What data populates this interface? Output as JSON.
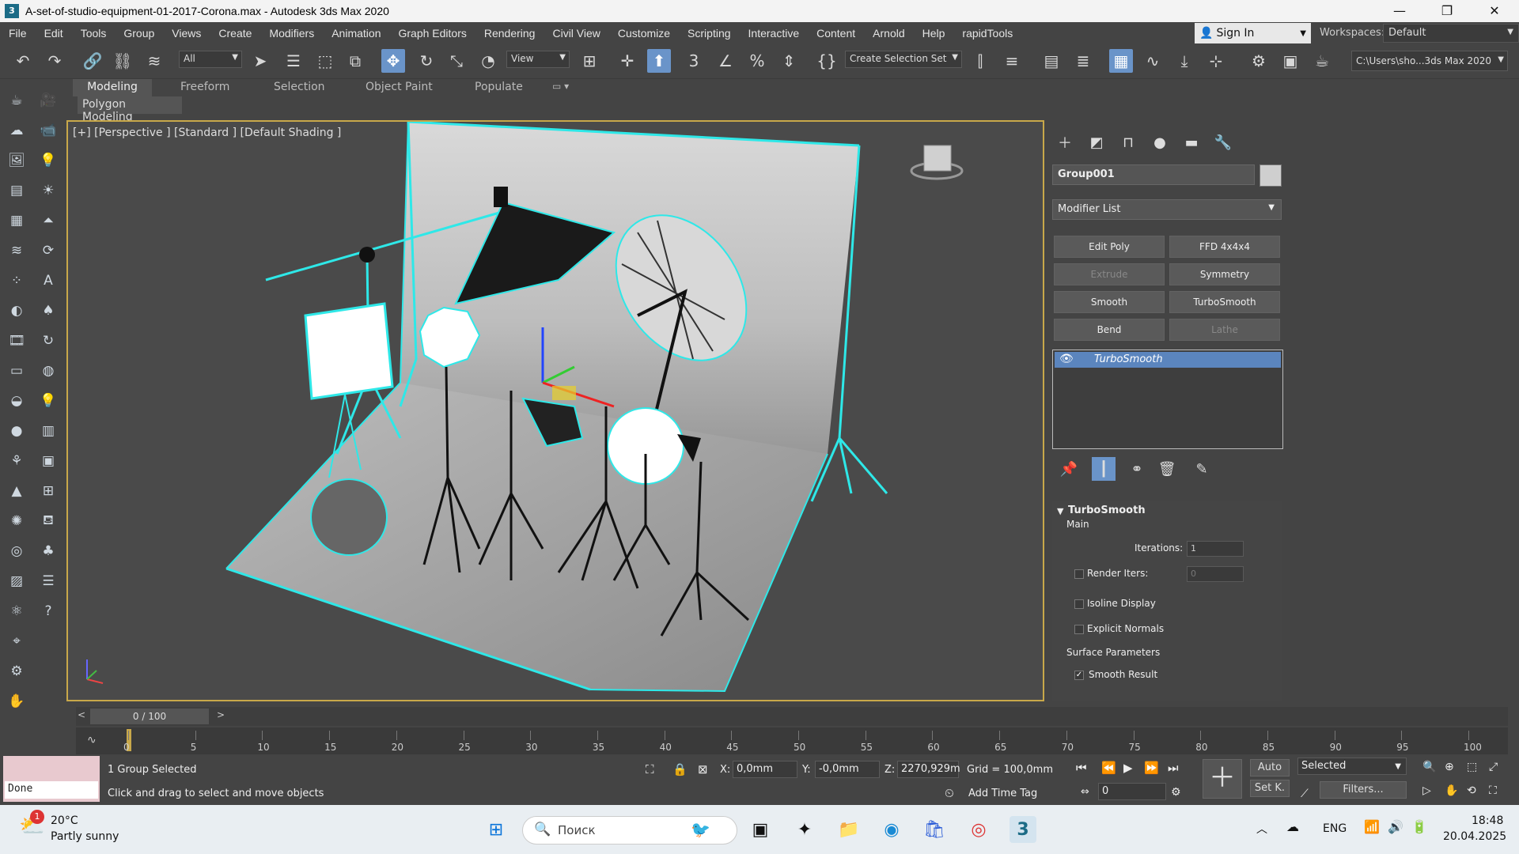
{
  "window": {
    "title": "A-set-of-studio-equipment-01-2017-Corona.max - Autodesk 3ds Max 2020",
    "app_icon": "3",
    "controls": [
      "—",
      "❐",
      "✕"
    ]
  },
  "menu": {
    "items": [
      "File",
      "Edit",
      "Tools",
      "Group",
      "Views",
      "Create",
      "Modifiers",
      "Animation",
      "Graph Editors",
      "Rendering",
      "Civil View",
      "Customize",
      "Scripting",
      "Interactive",
      "Content",
      "Arnold",
      "Help",
      "rapidTools"
    ],
    "signin": "Sign In",
    "workspaces_label": "Workspaces:",
    "workspace_value": "Default"
  },
  "toolbar": {
    "filter_value": "All",
    "refcoord_value": "View",
    "selection_set": "Create Selection Set",
    "project_path": "C:\\Users\\sho...3ds Max 2020"
  },
  "ribbon": {
    "tabs": [
      "Modeling",
      "Freeform",
      "Selection",
      "Object Paint",
      "Populate"
    ],
    "panel": "Polygon Modeling"
  },
  "viewport": {
    "label": "[+] [Perspective ] [Standard ] [Default Shading ]",
    "selection_color": "#2ee8e8",
    "border_color": "#c8a84a"
  },
  "command_panel": {
    "object_name": "Group001",
    "object_color": "#cfcfcf",
    "modifier_list": "Modifier List",
    "buttons": [
      {
        "label": "Edit Poly",
        "enabled": true
      },
      {
        "label": "FFD 4x4x4",
        "enabled": true
      },
      {
        "label": "Extrude",
        "enabled": false
      },
      {
        "label": "Symmetry",
        "enabled": true
      },
      {
        "label": "Smooth",
        "enabled": true
      },
      {
        "label": "TurboSmooth",
        "enabled": true
      },
      {
        "label": "Bend",
        "enabled": true
      },
      {
        "label": "Lathe",
        "enabled": false
      }
    ],
    "stack_item": "TurboSmooth",
    "rollout": {
      "title": "TurboSmooth",
      "main_label": "Main",
      "iterations_label": "Iterations:",
      "iterations_value": "1",
      "render_iters_label": "Render Iters:",
      "render_iters_value": "0",
      "isoline_label": "Isoline Display",
      "explicit_label": "Explicit Normals",
      "surface_label": "Surface Parameters",
      "smooth_result_label": "Smooth Result"
    }
  },
  "timeline": {
    "frame_display": "0 / 100",
    "prev": "<",
    "next": ">",
    "ticks": [
      "0",
      "5",
      "10",
      "15",
      "20",
      "25",
      "30",
      "35",
      "40",
      "45",
      "50",
      "55",
      "60",
      "65",
      "70",
      "75",
      "80",
      "85",
      "90",
      "95",
      "100"
    ]
  },
  "status": {
    "done": "Done",
    "selected_text": "1 Group Selected",
    "hint_text": "Click and drag to select and move objects",
    "x_label": "X:",
    "x_value": "0,0mm",
    "y_label": "Y:",
    "y_value": "-0,0mm",
    "z_label": "Z:",
    "z_value": "2270,929m",
    "grid": "Grid = 100,0mm",
    "add_time_tag": "Add Time Tag",
    "auto": "Auto",
    "setk": "Set K.",
    "selected_dd": "Selected",
    "filters": "Filters...",
    "frame_field": "0"
  },
  "taskbar": {
    "temperature": "20°C",
    "weather": "Partly sunny",
    "badge": "1",
    "search_placeholder": "Поиск",
    "lang": "ENG",
    "time": "18:48",
    "date": "20.04.2025"
  }
}
